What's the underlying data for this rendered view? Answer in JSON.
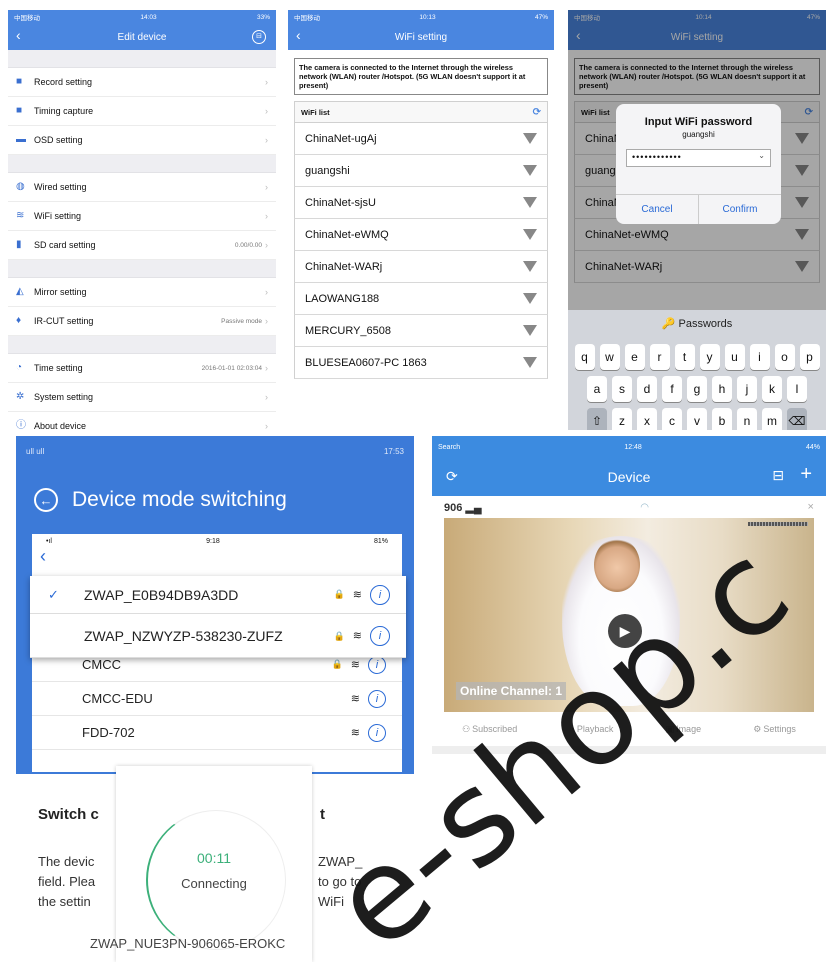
{
  "panel1": {
    "status": {
      "left": "中国移动",
      "time": "14:03",
      "right": "33%"
    },
    "title": "Edit device",
    "groups": [
      [
        {
          "icon": "camera-icon",
          "label": "Record setting",
          "value": ""
        },
        {
          "icon": "camera-icon",
          "label": "Timing capture",
          "value": ""
        },
        {
          "icon": "screen-icon",
          "label": "OSD setting",
          "value": ""
        }
      ],
      [
        {
          "icon": "globe-icon",
          "label": "Wired setting",
          "value": ""
        },
        {
          "icon": "wifi-icon",
          "label": "WiFi setting",
          "value": ""
        },
        {
          "icon": "sd-card-icon",
          "label": "SD card setting",
          "value": "0.00/0.00"
        }
      ],
      [
        {
          "icon": "mirror-icon",
          "label": "Mirror setting",
          "value": ""
        },
        {
          "icon": "bulb-icon",
          "label": "IR-CUT setting",
          "value": "Passive mode"
        }
      ],
      [
        {
          "icon": "clock-icon",
          "label": "Time setting",
          "value": "2016-01-01 02:03:04"
        },
        {
          "icon": "gear-icon",
          "label": "System setting",
          "value": ""
        },
        {
          "icon": "info-icon",
          "label": "About device",
          "value": ""
        }
      ]
    ]
  },
  "panel2": {
    "status": {
      "left": "中国移动",
      "time": "10:13",
      "right": "47%"
    },
    "title": "WiFi setting",
    "note": "The camera is connected to the Internet through the wireless network (WLAN) router /Hotspot. (5G WLAN doesn't support it at present)",
    "list_title": "WiFi list",
    "networks": [
      "ChinaNet-ugAj",
      "guangshi",
      "ChinaNet-sjsU",
      "ChinaNet-eWMQ",
      "ChinaNet-WARj",
      "LAOWANG188",
      "MERCURY_6508",
      "BLUESEA0607-PC 1863"
    ]
  },
  "panel3": {
    "status": {
      "left": "中国移动",
      "time": "10:14",
      "right": "47%"
    },
    "title": "WiFi setting",
    "note": "The camera is connected to the Internet through the wireless network (WLAN) router /Hotspot. (5G WLAN doesn't support it at present)",
    "list_title": "WiFi list",
    "networks": [
      "ChinaNet-ugAj",
      "guangshi",
      "ChinaNet-sjsU",
      "ChinaNet-eWMQ",
      "ChinaNet-WARj"
    ],
    "dialog": {
      "title": "Input WiFi password",
      "subtitle": "guangshi",
      "password": "••••••••••••",
      "cancel": "Cancel",
      "confirm": "Confirm"
    },
    "keyboard": {
      "bar": "Passwords",
      "row1": [
        "q",
        "w",
        "e",
        "r",
        "t",
        "y",
        "u",
        "i",
        "o",
        "p"
      ],
      "row2": [
        "a",
        "s",
        "d",
        "f",
        "g",
        "h",
        "j",
        "k",
        "l"
      ],
      "row3": [
        "z",
        "x",
        "c",
        "v",
        "b",
        "n",
        "m"
      ]
    }
  },
  "panel4": {
    "status": {
      "left": "ull ull",
      "right": "17:53"
    },
    "title": "Device mode switching",
    "inner_status": {
      "time": "9:18",
      "right": "81%"
    },
    "selected_network": "ZWAP_E0B94DB9A3DD",
    "second_network": "ZWAP_NZWYZP-538230-ZUFZ",
    "networks": [
      "CMCC",
      "CMCC-EDU",
      "FDD-702"
    ],
    "heading": "Switch c",
    "heading_tail": "t",
    "body_left": [
      "The devic",
      "field. Plea",
      "the settin"
    ],
    "body_right": [
      "ZWAP_",
      "to go to",
      "WiFi"
    ],
    "overlay": {
      "time": "00:11",
      "label": "Connecting"
    },
    "bottom": "ZWAP_NUE3PN-906065-EROKC"
  },
  "panel5": {
    "status": {
      "left": "Search",
      "time": "12:48",
      "right": "44%"
    },
    "title": "Device",
    "device_name": "906",
    "online": "Online Channel: 1",
    "tabs": [
      "Subscribed",
      "Playback",
      "Image",
      "Settings"
    ]
  },
  "watermark": "e-shop.c"
}
